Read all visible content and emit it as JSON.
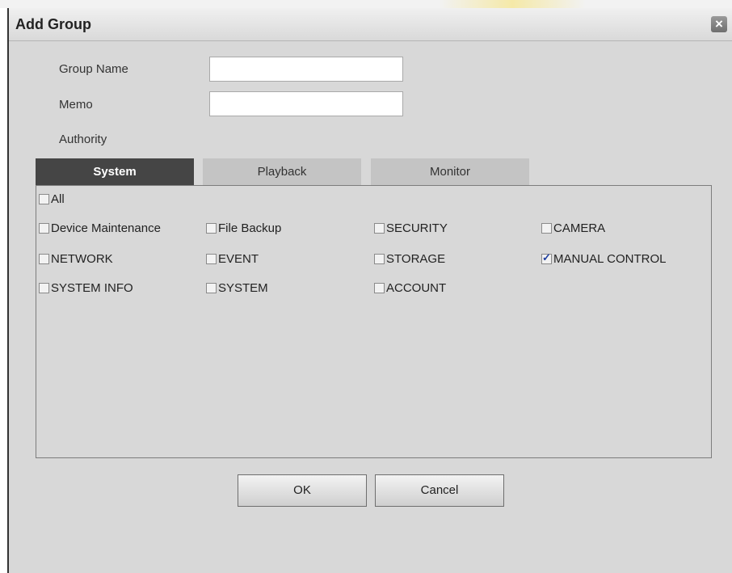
{
  "dialog": {
    "title": "Add Group",
    "close_symbol": "×"
  },
  "form": {
    "group_name_label": "Group Name",
    "group_name_value": "",
    "memo_label": "Memo",
    "memo_value": "",
    "authority_label": "Authority"
  },
  "tabs": [
    {
      "label": "System",
      "active": true
    },
    {
      "label": "Playback",
      "active": false
    },
    {
      "label": "Monitor",
      "active": false
    }
  ],
  "permissions": {
    "all": {
      "label": "All",
      "checked": false
    },
    "items": [
      {
        "label": "Device Maintenance",
        "checked": false
      },
      {
        "label": "File Backup",
        "checked": false
      },
      {
        "label": "SECURITY",
        "checked": false
      },
      {
        "label": "CAMERA",
        "checked": false
      },
      {
        "label": "NETWORK",
        "checked": false
      },
      {
        "label": "EVENT",
        "checked": false
      },
      {
        "label": "STORAGE",
        "checked": false
      },
      {
        "label": "MANUAL CONTROL",
        "checked": true
      },
      {
        "label": "SYSTEM INFO",
        "checked": false
      },
      {
        "label": "SYSTEM",
        "checked": false
      },
      {
        "label": "ACCOUNT",
        "checked": false
      }
    ]
  },
  "buttons": {
    "ok_label": "OK",
    "cancel_label": "Cancel"
  }
}
